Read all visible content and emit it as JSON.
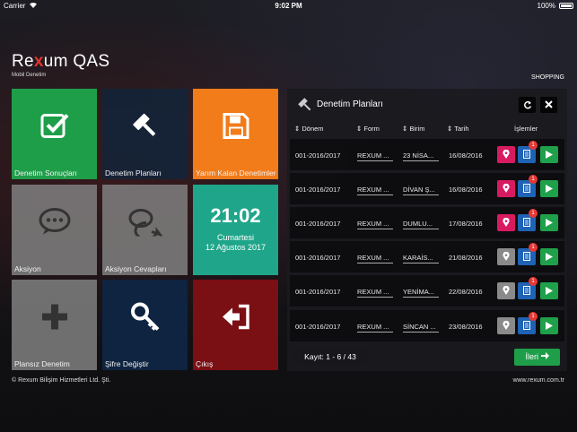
{
  "status_bar": {
    "carrier": "Carrier",
    "time": "9:02 PM",
    "battery": "100%"
  },
  "brand": {
    "logo_pre": "Re",
    "logo_x": "x",
    "logo_post": "um QAS",
    "subtitle": "Mobil Denetim",
    "shopping": "SHOPPING"
  },
  "tiles": {
    "denetim_sonuclari": "Denetim Sonuçları",
    "denetim_planlari": "Denetim Planları",
    "yarim_kalan": "Yarım Kalan Denetimler",
    "aksiyon": "Aksiyon",
    "aksiyon_cevaplari": "Aksiyon Cevapları",
    "plansiz": "Plansız Denetim",
    "sifre": "Şifre Değiştir",
    "cikis": "Çıkış"
  },
  "clock": {
    "time": "21:02",
    "day": "Cumartesi",
    "date": "12 Ağustos 2017"
  },
  "panel": {
    "title": "Denetim Planları",
    "columns": [
      "Dönem",
      "Form",
      "Birim",
      "Tarih",
      "İşlemler"
    ],
    "rows": [
      {
        "donem": "001-2016/2017",
        "form": "REXUM ...",
        "birim": "23 NİSA...",
        "tarih": "16/08/2016",
        "badge": "1",
        "pin_active": true
      },
      {
        "donem": "001-2016/2017",
        "form": "REXUM ...",
        "birim": "DİVAN Ş...",
        "tarih": "16/08/2016",
        "badge": "1",
        "pin_active": true
      },
      {
        "donem": "001-2016/2017",
        "form": "REXUM ...",
        "birim": "DUMLU...",
        "tarih": "17/08/2016",
        "badge": "1",
        "pin_active": true
      },
      {
        "donem": "001-2016/2017",
        "form": "REXUM ...",
        "birim": "KARAİS...",
        "tarih": "21/08/2016",
        "badge": "1",
        "pin_active": false
      },
      {
        "donem": "001-2016/2017",
        "form": "REXUM ...",
        "birim": "YENİMA...",
        "tarih": "22/08/2016",
        "badge": "1",
        "pin_active": false
      },
      {
        "donem": "001-2016/2017",
        "form": "REXUM ...",
        "birim": "SİNCAN ...",
        "tarih": "23/08/2016",
        "badge": "1",
        "pin_active": false
      }
    ],
    "pager": "Kayıt: 1 - 6 / 43",
    "next": "İleri"
  },
  "footer": {
    "copyright": "© Rexum Bilişim Hizmetleri Ltd. Şti.",
    "website": "www.rexum.com.tr"
  },
  "colors": {
    "green": "#1f9e4a",
    "orange": "#f27b1a",
    "teal": "#1fa68a",
    "red": "#7a0f14",
    "pink": "#d81b60",
    "blue": "#1e63b5"
  }
}
